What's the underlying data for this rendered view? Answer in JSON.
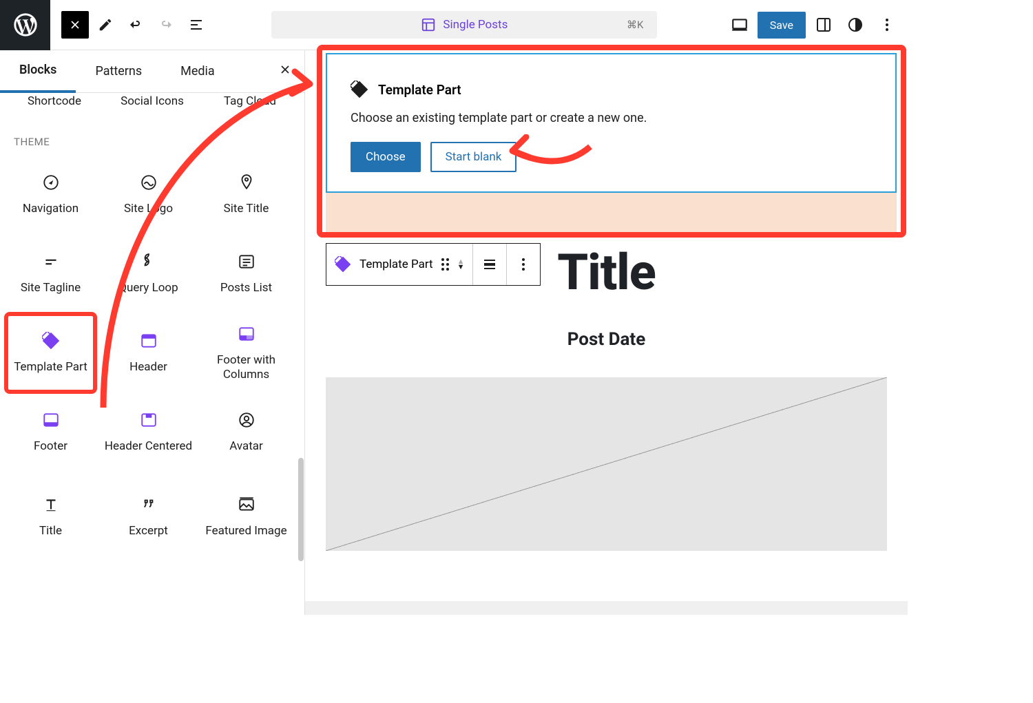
{
  "topbar": {
    "template_label": "Single Posts",
    "shortcut": "⌘K",
    "save_label": "Save"
  },
  "inserter": {
    "tabs": {
      "blocks": "Blocks",
      "patterns": "Patterns",
      "media": "Media"
    },
    "cut_row": [
      "Shortcode",
      "Social Icons",
      "Tag Cloud"
    ],
    "section_label": "THEME",
    "blocks": [
      {
        "label": "Navigation",
        "icon": "compass"
      },
      {
        "label": "Site Logo",
        "icon": "sitelogo"
      },
      {
        "label": "Site Title",
        "icon": "mappin"
      },
      {
        "label": "Site Tagline",
        "icon": "tagline"
      },
      {
        "label": "Query Loop",
        "icon": "loop"
      },
      {
        "label": "Posts List",
        "icon": "postslist"
      },
      {
        "label": "Template Part",
        "icon": "templatepart",
        "purple": true,
        "highlight": true
      },
      {
        "label": "Header",
        "icon": "header",
        "purple": true
      },
      {
        "label": "Footer with Columns",
        "icon": "footercols",
        "purple": true
      },
      {
        "label": "Footer",
        "icon": "footer",
        "purple": true
      },
      {
        "label": "Header Centered",
        "icon": "headercentered",
        "purple": true
      },
      {
        "label": "Avatar",
        "icon": "avatar"
      },
      {
        "label": "Title",
        "icon": "title"
      },
      {
        "label": "Excerpt",
        "icon": "excerpt"
      },
      {
        "label": "Featured Image",
        "icon": "featured"
      }
    ]
  },
  "placeholder": {
    "title": "Template Part",
    "description": "Choose an existing template part or create a new one.",
    "choose": "Choose",
    "start_blank": "Start blank"
  },
  "toolbar": {
    "label": "Template Part"
  },
  "canvas": {
    "title": "Title",
    "date": "Post Date"
  }
}
